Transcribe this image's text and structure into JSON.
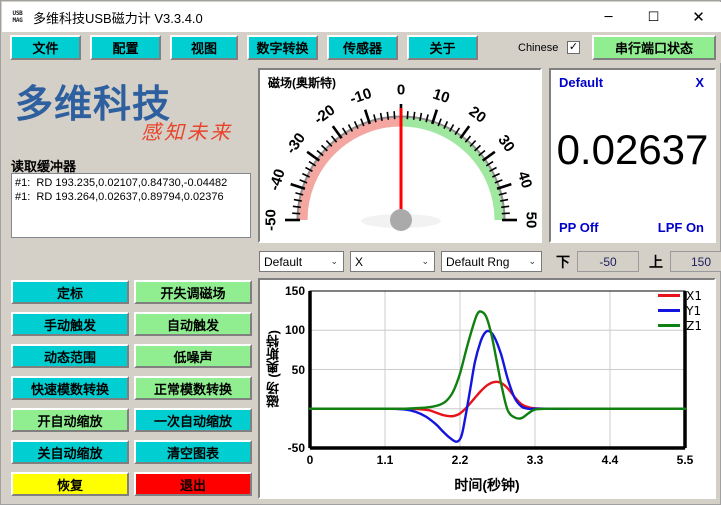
{
  "window": {
    "title": "多维科技USB磁力计 V3.3.4.0",
    "icon_line1": "USB",
    "icon_line2": "MAG",
    "minimize": "─",
    "maximize": "☐",
    "close": "✕"
  },
  "menubar": {
    "buttons": [
      {
        "label": "文件",
        "name": "menu-file"
      },
      {
        "label": "配置",
        "name": "menu-config"
      },
      {
        "label": "视图",
        "name": "menu-view"
      },
      {
        "label": "数字转换",
        "name": "menu-digital-conversion"
      },
      {
        "label": "传感器",
        "name": "menu-sensor"
      },
      {
        "label": "关于",
        "name": "menu-about"
      }
    ],
    "language_label": "Chinese",
    "language_checked": "✓",
    "port_status_button": "串行端口状态",
    "accent_cyan": "#00ced1",
    "accent_green": "#90ee90"
  },
  "logo": {
    "main": "多维科技",
    "slogan": "感知未来",
    "main_color": "#2e5f9e",
    "slogan_color": "#e8442a"
  },
  "buffer": {
    "label": "读取缓冲器",
    "lines": [
      "#1:  RD 193.235,0.02107,0.84730,-0.04482",
      "#1:  RD 193.264,0.02637,0.89794,0.02376"
    ]
  },
  "side_buttons": [
    {
      "label": "定标",
      "color": "#00ced1",
      "name": "btn-calibrate"
    },
    {
      "label": "开失调磁场",
      "color": "#90ee90",
      "name": "btn-offset-field-on"
    },
    {
      "label": "手动触发",
      "color": "#00ced1",
      "name": "btn-manual-trigger"
    },
    {
      "label": "自动触发",
      "color": "#90ee90",
      "name": "btn-auto-trigger"
    },
    {
      "label": "动态范围",
      "color": "#00ced1",
      "name": "btn-dynamic-range"
    },
    {
      "label": "低噪声",
      "color": "#90ee90",
      "name": "btn-low-noise"
    },
    {
      "label": "快速模数转换",
      "color": "#00ced1",
      "name": "btn-fast-adc"
    },
    {
      "label": "正常模数转换",
      "color": "#90ee90",
      "name": "btn-normal-adc"
    },
    {
      "label": "开自动缩放",
      "color": "#90ee90",
      "name": "btn-autoscale-on"
    },
    {
      "label": "一次自动缩放",
      "color": "#00ced1",
      "name": "btn-autoscale-once"
    },
    {
      "label": "关自动缩放",
      "color": "#00ced1",
      "name": "btn-autoscale-off"
    },
    {
      "label": "清空图表",
      "color": "#00ced1",
      "name": "btn-clear-chart"
    },
    {
      "label": "恢复",
      "color": "#ffff00",
      "name": "btn-restore"
    },
    {
      "label": "退出",
      "color": "#ff0000",
      "name": "btn-exit"
    }
  ],
  "gauge": {
    "title": "磁场(奥斯特)",
    "min": -50,
    "max": 50,
    "value": 0,
    "ticks": [
      -50,
      -40,
      -30,
      -20,
      -10,
      0,
      10,
      20,
      30,
      40,
      50
    ],
    "negative_color": "#f4a6a0",
    "positive_color": "#a0e8a0",
    "needle_color": "#ff0000"
  },
  "readout": {
    "top_left": "Default",
    "top_right": "X",
    "value": "0.02637",
    "bottom_left": "PP Off",
    "bottom_right": "LPF On",
    "text_color": "#0000cc"
  },
  "controls": {
    "sensor_select": "Default",
    "axis_select": "X",
    "range_select": "Default Rng",
    "lower_icon": "下",
    "lower_value": "-50",
    "upper_icon": "上",
    "upper_value": "150",
    "chevron": "⌄"
  },
  "chart_data": {
    "type": "line",
    "title": "",
    "xlabel": "时间(秒钟)",
    "ylabel": "磁场 (奥斯特)",
    "xticks": [
      "0",
      "1.1",
      "2.2",
      "3.3",
      "4.4",
      "5.5"
    ],
    "yticks": [
      "150",
      "100",
      "50",
      "-50"
    ],
    "xlim": [
      0,
      5.5
    ],
    "ylim": [
      -50,
      150
    ],
    "grid": true,
    "legend_position": "top-right",
    "series": [
      {
        "name": "X1",
        "color": "#e8131a",
        "x": [
          0,
          0.2,
          0.4,
          0.6,
          0.8,
          1.0,
          1.2,
          1.4,
          1.6,
          1.75,
          1.85,
          1.95,
          2.05,
          2.12,
          2.2,
          2.3,
          2.4,
          2.5,
          2.6,
          2.7,
          2.8,
          2.9,
          3.0,
          3.1,
          3.2,
          3.3,
          3.5,
          3.8,
          4.2,
          4.6,
          5.0,
          5.5
        ],
        "values": [
          0,
          0,
          0,
          0,
          0,
          0,
          0,
          0,
          -0.5,
          -2,
          -5,
          -8,
          -9.5,
          -9,
          -6,
          2,
          12,
          22,
          30,
          34,
          33,
          26,
          15,
          6,
          2,
          0.5,
          0,
          0,
          0,
          0,
          0,
          0
        ]
      },
      {
        "name": "Y1",
        "color": "#1414e0",
        "x": [
          0,
          0.2,
          0.4,
          0.6,
          0.8,
          1.0,
          1.2,
          1.4,
          1.55,
          1.7,
          1.85,
          1.95,
          2.05,
          2.15,
          2.22,
          2.28,
          2.35,
          2.42,
          2.5,
          2.56,
          2.62,
          2.7,
          2.8,
          2.9,
          3.0,
          3.1,
          3.2,
          3.3,
          3.5,
          3.8,
          4.2,
          4.6,
          5.0,
          5.5
        ],
        "values": [
          0,
          0,
          0,
          0,
          0,
          0,
          0,
          -1,
          -4,
          -10,
          -20,
          -29,
          -37,
          -42,
          -35,
          -10,
          25,
          60,
          85,
          96,
          99,
          92,
          70,
          38,
          14,
          3,
          0,
          0,
          0,
          0,
          0,
          0,
          0,
          0
        ]
      },
      {
        "name": "Z1",
        "color": "#108010",
        "x": [
          0,
          0.2,
          0.4,
          0.6,
          0.8,
          1.0,
          1.2,
          1.4,
          1.6,
          1.75,
          1.9,
          2.0,
          2.1,
          2.2,
          2.3,
          2.4,
          2.45,
          2.5,
          2.58,
          2.66,
          2.74,
          2.82,
          2.9,
          3.0,
          3.1,
          3.2,
          3.3,
          3.5,
          3.8,
          4.2,
          4.6,
          5.0,
          5.5
        ],
        "values": [
          0,
          0,
          0,
          0,
          0,
          0,
          0,
          0,
          1,
          2,
          5,
          10,
          22,
          45,
          78,
          108,
          120,
          124,
          118,
          95,
          60,
          25,
          -2,
          -11,
          -12,
          -6,
          -1,
          0,
          0,
          0,
          0,
          0,
          0
        ]
      }
    ]
  }
}
